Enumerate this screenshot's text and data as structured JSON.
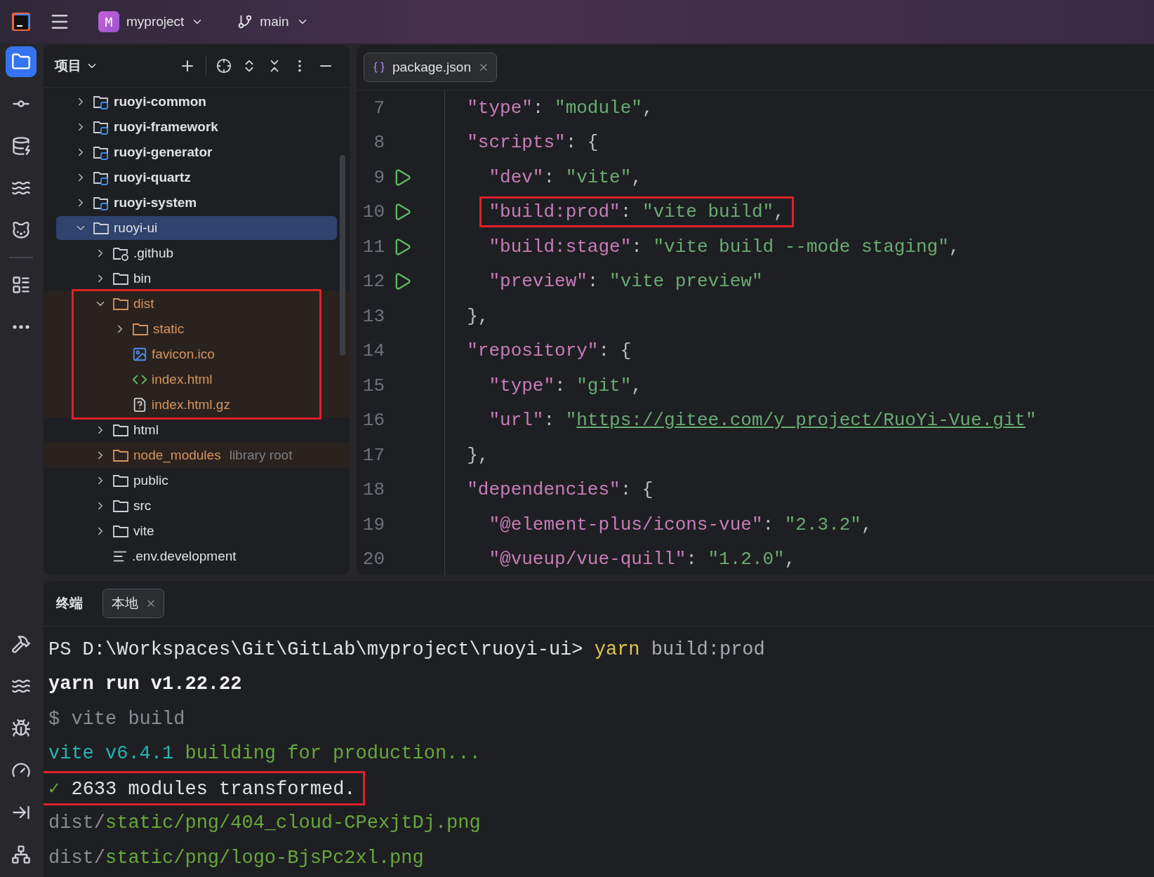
{
  "title_bar": {
    "project_badge": "M",
    "project": "myproject",
    "branch": "main"
  },
  "tool_strip": {
    "top": [
      {
        "kind": "project",
        "selected": true
      },
      {
        "kind": "commit",
        "selected": false
      },
      {
        "kind": "database",
        "selected": false
      },
      {
        "kind": "problems",
        "selected": false
      },
      {
        "kind": "gitlab",
        "selected": false
      },
      {
        "kind": "structure",
        "selected": false
      },
      {
        "kind": "more",
        "selected": false
      }
    ],
    "bottom": [
      {
        "kind": "build",
        "selected": false
      },
      {
        "kind": "services",
        "selected": false
      },
      {
        "kind": "debug",
        "selected": false
      },
      {
        "kind": "profiler",
        "selected": false
      },
      {
        "kind": "deploy",
        "selected": false
      },
      {
        "kind": "network",
        "selected": false
      }
    ]
  },
  "project_panel": {
    "title": "项目",
    "tree": [
      {
        "name": "ruoyi-common",
        "kind": "module",
        "expanded": false,
        "selected": false,
        "excluded": false,
        "boxed": false
      },
      {
        "name": "ruoyi-framework",
        "kind": "module",
        "expanded": false,
        "selected": false,
        "excluded": false,
        "boxed": false
      },
      {
        "name": "ruoyi-generator",
        "kind": "module",
        "expanded": false,
        "selected": false,
        "excluded": false,
        "boxed": false
      },
      {
        "name": "ruoyi-quartz",
        "kind": "module",
        "expanded": false,
        "selected": false,
        "excluded": false,
        "boxed": false
      },
      {
        "name": "ruoyi-system",
        "kind": "module",
        "expanded": false,
        "selected": false,
        "excluded": false,
        "boxed": false
      },
      {
        "name": "ruoyi-ui",
        "kind": "folder",
        "expanded": true,
        "selected": true,
        "excluded": false,
        "boxed": false,
        "children": [
          {
            "name": ".github",
            "kind": "github-folder",
            "expanded": false,
            "selected": false,
            "excluded": false,
            "boxed": false
          },
          {
            "name": "bin",
            "kind": "folder",
            "expanded": false,
            "selected": false,
            "excluded": false,
            "boxed": false
          },
          {
            "name": "dist",
            "kind": "folder",
            "expanded": true,
            "selected": false,
            "excluded": true,
            "boxed": true,
            "children": [
              {
                "name": "static",
                "kind": "folder",
                "expanded": false,
                "selected": false,
                "excluded": true,
                "boxed": false
              },
              {
                "name": "favicon.ico",
                "kind": "image",
                "selected": false,
                "excluded": true,
                "boxed": false
              },
              {
                "name": "index.html",
                "kind": "html",
                "selected": false,
                "excluded": true,
                "boxed": false
              },
              {
                "name": "index.html.gz",
                "kind": "unknown",
                "selected": false,
                "excluded": true,
                "boxed": false
              }
            ]
          },
          {
            "name": "html",
            "kind": "folder",
            "expanded": false,
            "selected": false,
            "excluded": false,
            "boxed": false
          },
          {
            "name": "node_modules",
            "kind": "folder",
            "expanded": false,
            "selected": false,
            "excluded": true,
            "boxed": false,
            "note": "library root"
          },
          {
            "name": "public",
            "kind": "folder",
            "expanded": false,
            "selected": false,
            "excluded": false,
            "boxed": false
          },
          {
            "name": "src",
            "kind": "folder",
            "expanded": false,
            "selected": false,
            "excluded": false,
            "boxed": false
          },
          {
            "name": "vite",
            "kind": "folder",
            "expanded": false,
            "selected": false,
            "excluded": false,
            "boxed": false
          },
          {
            "name": ".env.development",
            "kind": "text",
            "selected": false,
            "excluded": false,
            "boxed": false
          }
        ]
      }
    ]
  },
  "editor": {
    "tabs": [
      {
        "label": "package.json",
        "selected": true
      }
    ],
    "lines": [
      {
        "number": "7",
        "run": false,
        "boxed": false,
        "tokens": [
          {
            "kind": "key",
            "text": "  \"type\""
          },
          {
            "kind": "punct",
            "text": ": "
          },
          {
            "kind": "string",
            "text": "\"module\""
          },
          {
            "kind": "punct",
            "text": ","
          }
        ]
      },
      {
        "number": "8",
        "run": false,
        "boxed": false,
        "tokens": [
          {
            "kind": "key",
            "text": "  \"scripts\""
          },
          {
            "kind": "punct",
            "text": ": {"
          }
        ]
      },
      {
        "number": "9",
        "run": true,
        "boxed": false,
        "tokens": [
          {
            "kind": "key",
            "text": "    \"dev\""
          },
          {
            "kind": "punct",
            "text": ": "
          },
          {
            "kind": "string",
            "text": "\"vite\""
          },
          {
            "kind": "punct",
            "text": ","
          }
        ]
      },
      {
        "number": "10",
        "run": true,
        "boxed": true,
        "tokens": [
          {
            "kind": "key",
            "text": "    \"build:prod\""
          },
          {
            "kind": "punct",
            "text": ": "
          },
          {
            "kind": "string",
            "text": "\"vite build\""
          },
          {
            "kind": "punct",
            "text": ","
          }
        ]
      },
      {
        "number": "11",
        "run": true,
        "boxed": false,
        "tokens": [
          {
            "kind": "key",
            "text": "    \"build:stage\""
          },
          {
            "kind": "punct",
            "text": ": "
          },
          {
            "kind": "string",
            "text": "\"vite build --mode staging\""
          },
          {
            "kind": "punct",
            "text": ","
          }
        ]
      },
      {
        "number": "12",
        "run": true,
        "boxed": false,
        "tokens": [
          {
            "kind": "key",
            "text": "    \"preview\""
          },
          {
            "kind": "punct",
            "text": ": "
          },
          {
            "kind": "string",
            "text": "\"vite preview\""
          }
        ]
      },
      {
        "number": "13",
        "run": false,
        "boxed": false,
        "tokens": [
          {
            "kind": "punct",
            "text": "  },"
          }
        ]
      },
      {
        "number": "14",
        "run": false,
        "boxed": false,
        "tokens": [
          {
            "kind": "key",
            "text": "  \"repository\""
          },
          {
            "kind": "punct",
            "text": ": {"
          }
        ]
      },
      {
        "number": "15",
        "run": false,
        "boxed": false,
        "tokens": [
          {
            "kind": "key",
            "text": "    \"type\""
          },
          {
            "kind": "punct",
            "text": ": "
          },
          {
            "kind": "string",
            "text": "\"git\""
          },
          {
            "kind": "punct",
            "text": ","
          }
        ]
      },
      {
        "number": "16",
        "run": false,
        "boxed": false,
        "tokens": [
          {
            "kind": "key",
            "text": "    \"url\""
          },
          {
            "kind": "punct",
            "text": ": "
          },
          {
            "kind": "string",
            "text": "\""
          },
          {
            "kind": "link",
            "text": "https://gitee.com/y_project/RuoYi-Vue.git"
          },
          {
            "kind": "string",
            "text": "\""
          }
        ]
      },
      {
        "number": "17",
        "run": false,
        "boxed": false,
        "tokens": [
          {
            "kind": "punct",
            "text": "  },"
          }
        ]
      },
      {
        "number": "18",
        "run": false,
        "boxed": false,
        "tokens": [
          {
            "kind": "key",
            "text": "  \"dependencies\""
          },
          {
            "kind": "punct",
            "text": ": {"
          }
        ]
      },
      {
        "number": "19",
        "run": false,
        "boxed": false,
        "tokens": [
          {
            "kind": "key",
            "text": "    \"@element-plus/icons-vue\""
          },
          {
            "kind": "punct",
            "text": ": "
          },
          {
            "kind": "string",
            "text": "\"2.3.2\""
          },
          {
            "kind": "punct",
            "text": ","
          }
        ]
      },
      {
        "number": "20",
        "run": false,
        "boxed": false,
        "tokens": [
          {
            "kind": "key",
            "text": "    \"@vueup/vue-quill\""
          },
          {
            "kind": "punct",
            "text": ": "
          },
          {
            "kind": "string",
            "text": "\"1.2.0\""
          },
          {
            "kind": "punct",
            "text": ","
          }
        ]
      }
    ]
  },
  "terminal": {
    "title": "终端",
    "tabs": [
      {
        "label": "本地",
        "selected": true
      }
    ],
    "lines": [
      {
        "boxed": false,
        "segments": [
          {
            "kind": "plain",
            "text": "PS D:\\Workspaces\\Git\\GitLab\\myproject\\ruoyi-ui> "
          },
          {
            "kind": "command",
            "text": "yarn"
          },
          {
            "kind": "argument",
            "text": " build:prod"
          }
        ]
      },
      {
        "boxed": false,
        "segments": [
          {
            "kind": "bold",
            "text": "yarn run v1.22.22"
          }
        ]
      },
      {
        "boxed": false,
        "segments": [
          {
            "kind": "dim",
            "text": "$ vite build"
          }
        ]
      },
      {
        "boxed": false,
        "segments": [
          {
            "kind": "cyan",
            "text": "vite v6.4.1 "
          },
          {
            "kind": "green",
            "text": "building for production..."
          }
        ]
      },
      {
        "boxed": true,
        "segments": [
          {
            "kind": "green",
            "text": "✓ "
          },
          {
            "kind": "plain",
            "text": "2633 modules transformed."
          }
        ]
      },
      {
        "boxed": false,
        "segments": [
          {
            "kind": "dim",
            "text": "dist/"
          },
          {
            "kind": "green",
            "text": "static/png/404_cloud-CPexjtDj.png"
          }
        ]
      },
      {
        "boxed": false,
        "segments": [
          {
            "kind": "dim",
            "text": "dist/"
          },
          {
            "kind": "green",
            "text": "static/png/logo-BjsPc2xl.png"
          }
        ]
      }
    ]
  }
}
